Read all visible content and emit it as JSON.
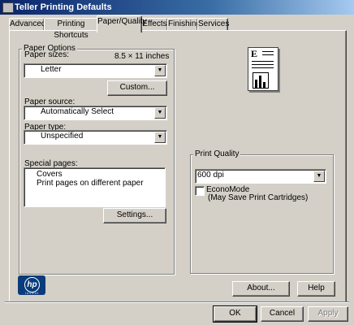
{
  "window": {
    "title": "Teller Printing Defaults"
  },
  "tabs": [
    {
      "label": "Advanced"
    },
    {
      "label": "Printing Shortcuts"
    },
    {
      "label": "Paper/Quality"
    },
    {
      "label": "Effects"
    },
    {
      "label": "Finishing"
    },
    {
      "label": "Services"
    }
  ],
  "paper_options": {
    "legend": "Paper Options",
    "sizes_label": "Paper sizes:",
    "size_dims": "8.5 × 11 inches",
    "size_value": "Letter",
    "custom_button": "Custom...",
    "source_label": "Paper source:",
    "source_value": "Automatically Select",
    "type_label": "Paper type:",
    "type_value": "Unspecified"
  },
  "special_pages": {
    "label": "Special pages:",
    "items": [
      "Covers",
      "Print pages on different paper"
    ],
    "settings_button": "Settings..."
  },
  "print_quality": {
    "legend": "Print Quality",
    "value": "600 dpi",
    "economode_label": "EconoMode",
    "economode_sub": "(May Save Print Cartridges)",
    "economode_checked": false
  },
  "preview": {
    "letter": "E"
  },
  "logo": {
    "brand": "hp",
    "tagline": "i n v e n t"
  },
  "buttons": {
    "about": "About...",
    "help": "Help",
    "ok": "OK",
    "cancel": "Cancel",
    "apply": "Apply"
  }
}
